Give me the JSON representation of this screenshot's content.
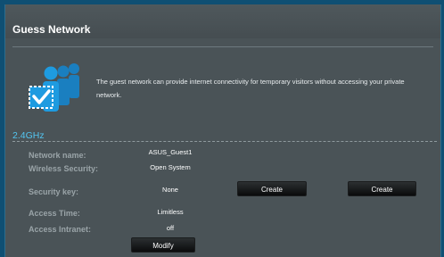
{
  "panel": {
    "title": "Guess Network"
  },
  "intro": {
    "icon": "guest-users-icon",
    "description": "The guest network can provide internet connectivity for temporary visitors without accessing your private network."
  },
  "band": {
    "label": "2.4GHz"
  },
  "rows": {
    "network_name": {
      "label": "Network name:",
      "value": "ASUS_Guest1"
    },
    "wireless_security": {
      "label": "Wireless Security:",
      "value": "Open System"
    },
    "security_key": {
      "label": "Security key:",
      "value": "None"
    },
    "access_time": {
      "label": "Access Time:",
      "value": "Limitless"
    },
    "access_intranet": {
      "label": "Access Intranet:",
      "value": "off"
    }
  },
  "buttons": {
    "create_1": "Create",
    "create_2": "Create",
    "modify": "Modify"
  },
  "colors": {
    "band_accent": "#53c5f0",
    "icon_blue": "#1e9be0"
  }
}
